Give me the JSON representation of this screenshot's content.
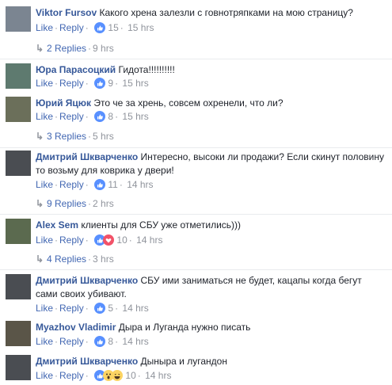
{
  "colors": {
    "link": "#365899",
    "action": "#4267b2",
    "meta": "#90949c"
  },
  "labels": {
    "like": "Like",
    "reply": "Reply"
  },
  "comments": [
    {
      "author": "Viktor Fursov",
      "text": "Какого хрена залезли с говнотряпками на мою страницу?",
      "reaction_count": "15",
      "time": "15 hrs",
      "replies": "2 Replies",
      "replies_time": "9 hrs",
      "icons": [
        "like-icon"
      ]
    },
    {
      "author": "Юра Парасоцкий",
      "text": "Гидота!!!!!!!!!!",
      "reaction_count": "9",
      "time": "15 hrs",
      "icons": [
        "like-icon"
      ]
    },
    {
      "author": "Юрий Яцюк",
      "text": "Это че за хрень, совсем охренели, что ли?",
      "reaction_count": "8",
      "time": "15 hrs",
      "replies": "3 Replies",
      "replies_time": "5 hrs",
      "icons": [
        "like-icon"
      ]
    },
    {
      "author": "Дмитрий Шкварченко",
      "text": "Интересно, высоки ли продажи? Если скинут половину то возьму для коврика у двери!",
      "reaction_count": "11",
      "time": "14 hrs",
      "replies": "9 Replies",
      "replies_time": "2 hrs",
      "icons": [
        "like-icon"
      ]
    },
    {
      "author": "Alex Sem",
      "text": "клиенты для СБУ уже отметились)))",
      "reaction_count": "10",
      "time": "14 hrs",
      "replies": "4 Replies",
      "replies_time": "3 hrs",
      "icons": [
        "like-icon",
        "love-icon"
      ]
    },
    {
      "author": "Дмитрий Шкварченко",
      "text": "СБУ ими заниматься не будет, кацапы когда бегут сами своих убивают.",
      "reaction_count": "5",
      "time": "14 hrs",
      "icons": [
        "like-icon"
      ]
    },
    {
      "author": "Myazhov Vladimir",
      "text": "Дыра и Луганда нужно писать",
      "reaction_count": "8",
      "time": "14 hrs",
      "icons": [
        "like-icon"
      ]
    },
    {
      "author": "Дмитрий Шкварченко",
      "text": "Дыныра и лугандон",
      "reaction_count": "10",
      "time": "14 hrs",
      "icons": [
        "like-icon",
        "wow-icon",
        "haha-icon"
      ]
    }
  ]
}
